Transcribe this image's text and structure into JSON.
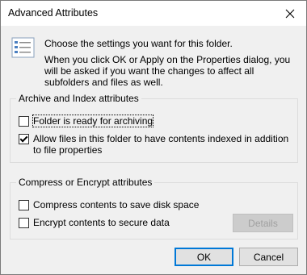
{
  "window": {
    "title": "Advanced Attributes"
  },
  "intro": {
    "line1": "Choose the settings you want for this folder.",
    "line2": "When you click OK or Apply on the Properties dialog, you will be asked if you want the changes to affect all subfolders and files as well."
  },
  "archive_group": {
    "label": "Archive and Index attributes",
    "folder_archive": {
      "label": "Folder is ready for archiving",
      "checked": false
    },
    "index_contents": {
      "label": "Allow files in this folder to have contents indexed in addition to file properties",
      "checked": true
    }
  },
  "compress_group": {
    "label": "Compress or Encrypt attributes",
    "compress": {
      "label": "Compress contents to save disk space",
      "checked": false
    },
    "encrypt": {
      "label": "Encrypt contents to secure data",
      "checked": false
    },
    "details_label": "Details"
  },
  "buttons": {
    "ok": "OK",
    "cancel": "Cancel"
  },
  "icons": {
    "close": "close-icon",
    "info": "settings-list-icon"
  },
  "colors": {
    "accent": "#0078d7",
    "titlebar": "#ffffff",
    "window_bg": "#f0f0f0"
  }
}
